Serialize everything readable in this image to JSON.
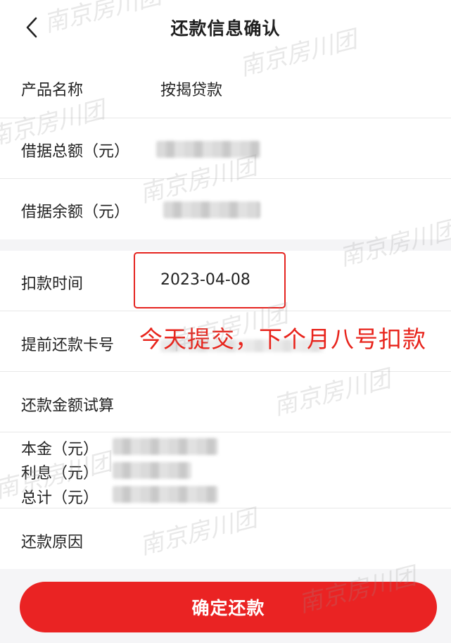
{
  "header": {
    "title": "还款信息确认"
  },
  "rows": {
    "product_label": "产品名称",
    "product_value": "按揭贷款",
    "loan_total_label": "借据总额（元）",
    "loan_balance_label": "借据余额（元）",
    "deduct_time_label": "扣款时间",
    "deduct_time_value": "2023-04-08",
    "card_label": "提前还款卡号",
    "calc_label": "还款金额试算",
    "principal_label": "本金（元）",
    "interest_label": "利息（元）",
    "total_label": "总计（元）",
    "reason_label": "还款原因"
  },
  "annotation": "今天提交，下个月八号扣款",
  "watermark": "南京房川团",
  "confirm_button": "确定还款",
  "colors": {
    "accent": "#ea2323",
    "annotation": "#e8241c"
  }
}
